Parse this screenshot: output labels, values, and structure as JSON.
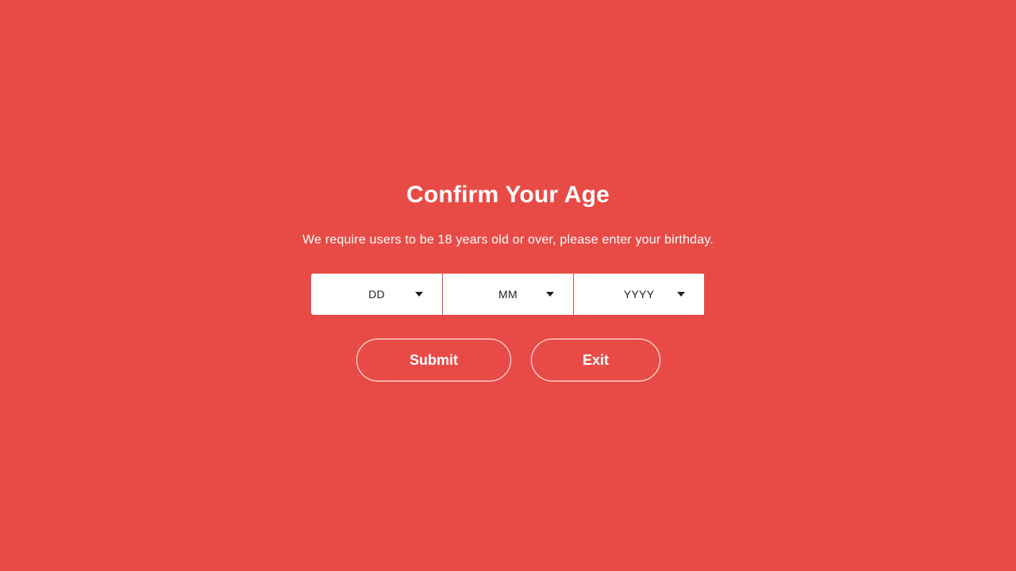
{
  "modal": {
    "title": "Confirm Your Age",
    "message": "We require users to be 18 years old or over, please enter your birthday."
  },
  "birthday": {
    "day": {
      "selected": "DD"
    },
    "month": {
      "selected": "MM"
    },
    "year": {
      "selected": "YYYY"
    }
  },
  "actions": {
    "submit_label": "Submit",
    "exit_label": "Exit"
  },
  "colors": {
    "background": "#e84b46",
    "text": "#ffffff",
    "select_background": "#ffffff",
    "select_text": "#222222"
  },
  "icons": {
    "dropdown": "caret-down-icon"
  }
}
